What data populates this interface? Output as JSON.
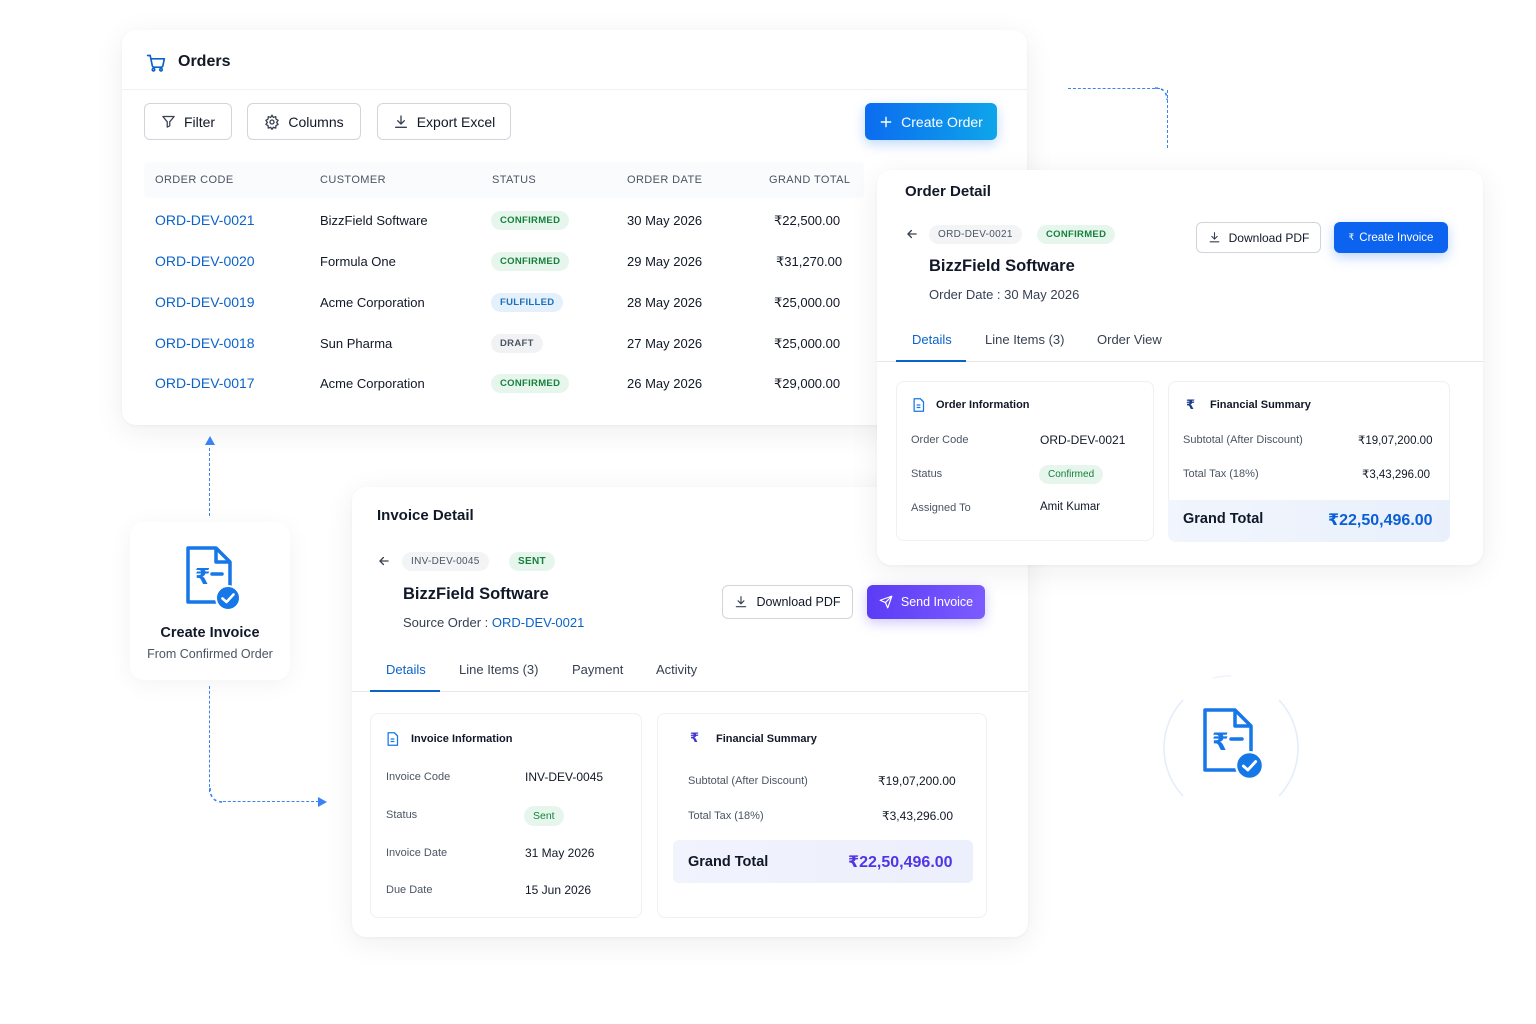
{
  "orders": {
    "title": "Orders",
    "toolbar": {
      "filter": "Filter",
      "columns": "Columns",
      "export": "Export Excel",
      "create": "Create Order"
    },
    "columns": [
      "ORDER CODE",
      "CUSTOMER",
      "STATUS",
      "ORDER DATE",
      "GRAND TOTAL"
    ],
    "rows": [
      {
        "code": "ORD-DEV-0021",
        "customer": "BizzField Software",
        "status": "CONFIRMED",
        "date": "30 May 2026",
        "total": "₹22,500.00"
      },
      {
        "code": "ORD-DEV-0020",
        "customer": "Formula One",
        "status": "CONFIRMED",
        "date": "29 May 2026",
        "total": "₹31,270.00"
      },
      {
        "code": "ORD-DEV-0019",
        "customer": "Acme Corporation",
        "status": "FULFILLED",
        "date": "28 May 2026",
        "total": "₹25,000.00"
      },
      {
        "code": "ORD-DEV-0018",
        "customer": "Sun Pharma",
        "status": "DRAFT",
        "date": "27 May 2026",
        "total": "₹25,000.00"
      },
      {
        "code": "ORD-DEV-0017",
        "customer": "Acme Corporation",
        "status": "CONFIRMED",
        "date": "26 May 2026",
        "total": "₹29,000.00"
      }
    ]
  },
  "order_detail": {
    "title": "Order Detail",
    "code": "ORD-DEV-0021",
    "status": "CONFIRMED",
    "customer": "BizzField Software",
    "order_date": "Order Date : 30 May 2026",
    "download": "Download PDF",
    "create_invoice": "Create Invoice",
    "tabs": [
      "Details",
      "Line Items (3)",
      "Order View"
    ],
    "info": {
      "title": "Order Information",
      "rows": [
        {
          "label": "Order Code",
          "value": "ORD-DEV-0021"
        },
        {
          "label": "Status",
          "value": "Confirmed"
        },
        {
          "label": "Assigned To",
          "value": "Amit Kumar"
        }
      ]
    },
    "summary": {
      "title": "Financial Summary",
      "subtotal_label": "Subtotal (After Discount)",
      "subtotal": "₹19,07,200.00",
      "tax_label": "Total Tax (18%)",
      "tax": "₹3,43,296.00",
      "grand_label": "Grand Total",
      "grand": "₹22,50,496.00"
    }
  },
  "invoice_detail": {
    "title": "Invoice Detail",
    "code": "INV-DEV-0045",
    "status": "SENT",
    "customer": "BizzField Software",
    "source_label": "Source Order : ",
    "source_code": "ORD-DEV-0021",
    "download": "Download PDF",
    "send": "Send Invoice",
    "tabs": [
      "Details",
      "Line Items (3)",
      "Payment",
      "Activity"
    ],
    "info": {
      "title": "Invoice Information",
      "rows": [
        {
          "label": "Invoice Code",
          "value": "INV-DEV-0045"
        },
        {
          "label": "Status",
          "value": "Sent"
        },
        {
          "label": "Invoice Date",
          "value": "31 May 2026"
        },
        {
          "label": "Due Date",
          "value": "15 Jun 2026"
        }
      ]
    },
    "summary": {
      "title": "Financial Summary",
      "subtotal_label": "Subtotal (After Discount)",
      "subtotal": "₹19,07,200.00",
      "tax_label": "Total Tax (18%)",
      "tax": "₹3,43,296.00",
      "grand_label": "Grand Total",
      "grand": "₹22,50,496.00"
    }
  },
  "create_invoice_card": {
    "title": "Create Invoice",
    "subtitle": "From Confirmed Order"
  },
  "colors": {
    "primary": "#0b63f0",
    "accent": "#0ea5e9",
    "purple": "#5b3cf5",
    "success": "#16803c"
  },
  "icons": [
    "cart-icon",
    "filter-icon",
    "gear-icon",
    "download-icon",
    "plus-icon",
    "arrow-left-icon",
    "document-icon",
    "rupee-icon",
    "invoice-rupee-icon",
    "check-badge-icon",
    "send-icon"
  ]
}
